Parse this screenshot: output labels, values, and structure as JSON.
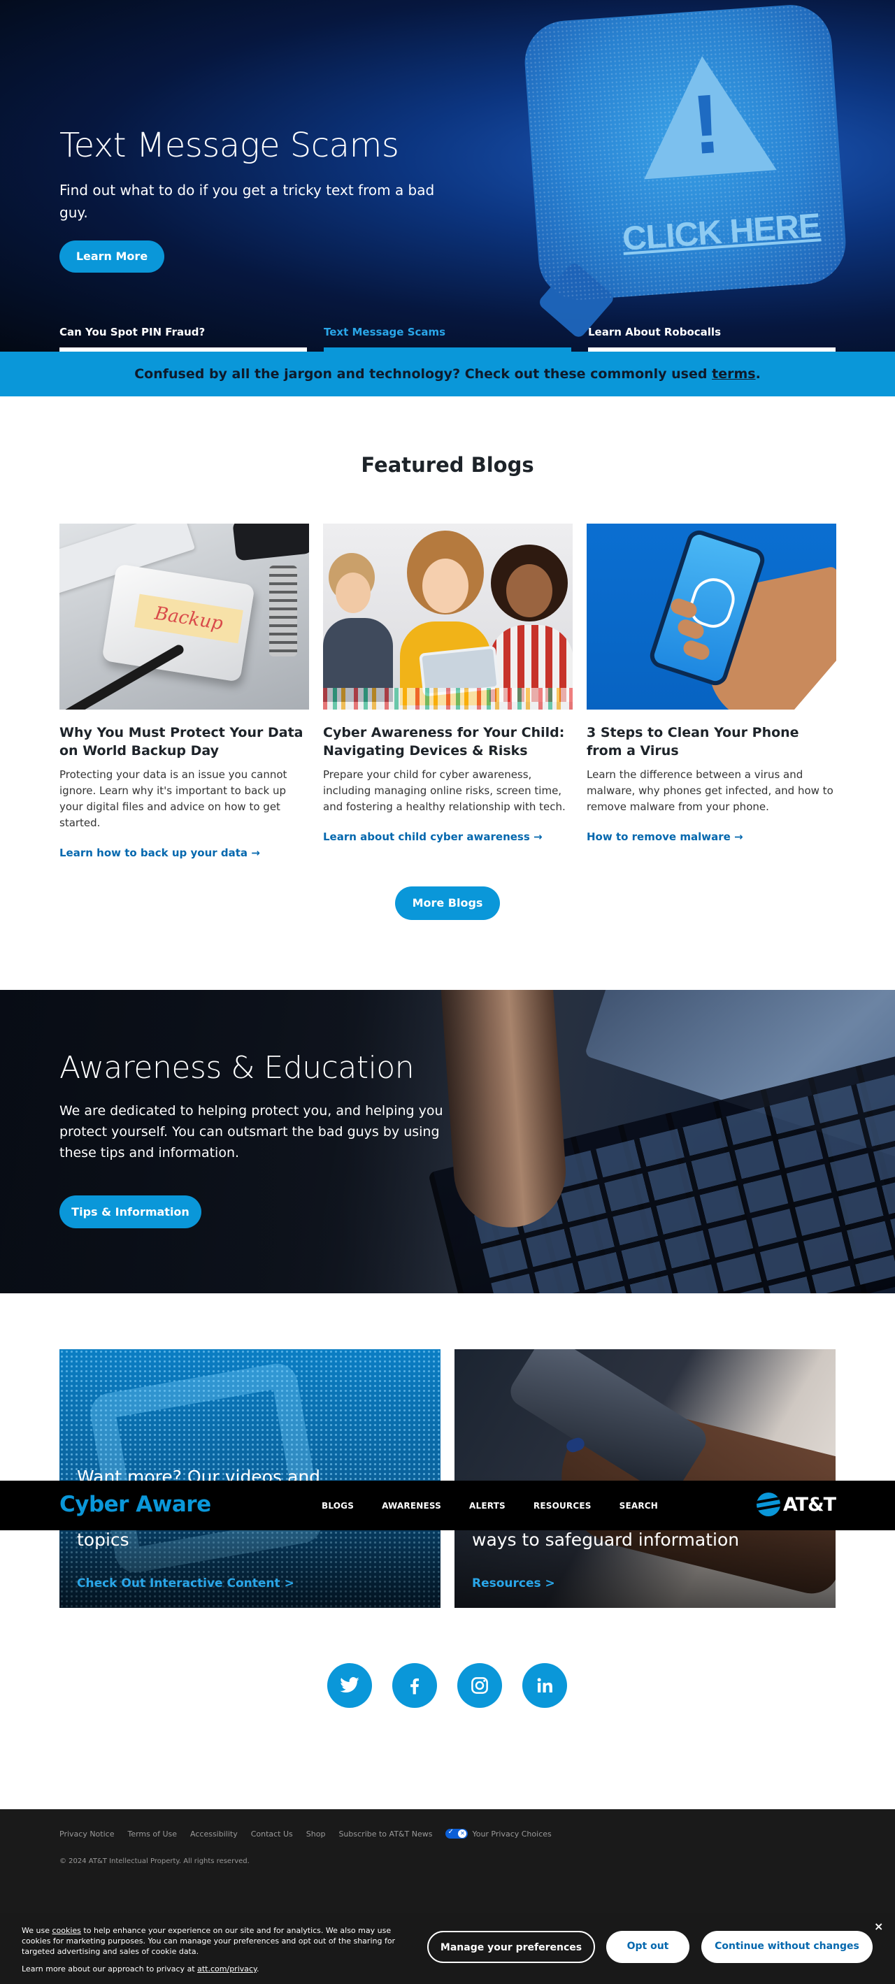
{
  "hero": {
    "title": "Text Message Scams",
    "subtitle": "Find out what to do if you get a tricky text from a bad guy.",
    "button": "Learn More",
    "image_text": "CLICK HERE",
    "image_symbol": "!",
    "tabs": [
      {
        "label": "Can You Spot PIN Fraud?",
        "active": false
      },
      {
        "label": "Text Message Scams",
        "active": true
      },
      {
        "label": "Learn About Robocalls",
        "active": false
      }
    ]
  },
  "jargon": {
    "text": "Confused by all the jargon and technology? Check out these commonly used ",
    "link": "terms",
    "end": "."
  },
  "featured": {
    "title": "Featured Blogs",
    "blogs": [
      {
        "image_label": "Backup",
        "title": "Why You Must Protect Your Data on World Backup Day",
        "desc": "Protecting your data is an issue you cannot ignore. Learn why it's important to back up your digital files and advice on how to get started.",
        "link": "Learn how to back up your data →"
      },
      {
        "title": "Cyber Awareness for Your Child: Navigating Devices & Risks",
        "desc": "Prepare your child for cyber awareness, including managing online risks, screen time, and fostering a healthy relationship with tech.",
        "link": "Learn about child cyber awareness →"
      },
      {
        "title": "3 Steps to Clean Your Phone from a Virus",
        "desc": "Learn the difference between a virus and malware, why phones get infected, and how to remove malware from your phone.",
        "link": "How to remove malware →"
      }
    ],
    "more_button": "More Blogs"
  },
  "awareness": {
    "title": "Awareness & Education",
    "desc": "We are dedicated to helping protect you, and helping you protect yourself. You can outsmart the bad guys by using these tips and information.",
    "button": "Tips & Information"
  },
  "cards": [
    {
      "line1": "Want more? Our videos and",
      "line2": "topics",
      "link": "Check Out Interactive Content >"
    },
    {
      "line2": "ways to safeguard information",
      "link": "Resources >"
    }
  ],
  "nav": {
    "brand": "Cyber Aware",
    "links": [
      "BLOGS",
      "AWARENESS",
      "ALERTS",
      "RESOURCES",
      "SEARCH"
    ],
    "logo_text": "AT&T"
  },
  "social": [
    {
      "name": "twitter"
    },
    {
      "name": "facebook"
    },
    {
      "name": "instagram"
    },
    {
      "name": "linkedin"
    }
  ],
  "footer": {
    "links": [
      "Privacy Notice",
      "Terms of Use",
      "Accessibility",
      "Contact Us",
      "Shop",
      "Subscribe to AT&T News"
    ],
    "privacy_choices": "Your Privacy Choices",
    "copyright": "© 2024 AT&T Intellectual Property. All rights reserved."
  },
  "cookie": {
    "text_pre": "We use ",
    "text_link": "cookies",
    "text_post": " to help enhance your experience on our site and for analytics. We also may use cookies for marketing purposes. You can manage your preferences and opt out of the sharing for targeted advertising and sales of cookie data.",
    "more_pre": "Learn more about our approach to privacy at ",
    "more_link": "att.com/privacy",
    "more_post": ".",
    "manage": "Manage your preferences",
    "opt_out": "Opt out",
    "continue": "Continue without changes",
    "close": "×"
  },
  "colors": {
    "accent": "#0a97d9",
    "link": "#0568ae",
    "footer_bg": "#1a1a1a"
  }
}
